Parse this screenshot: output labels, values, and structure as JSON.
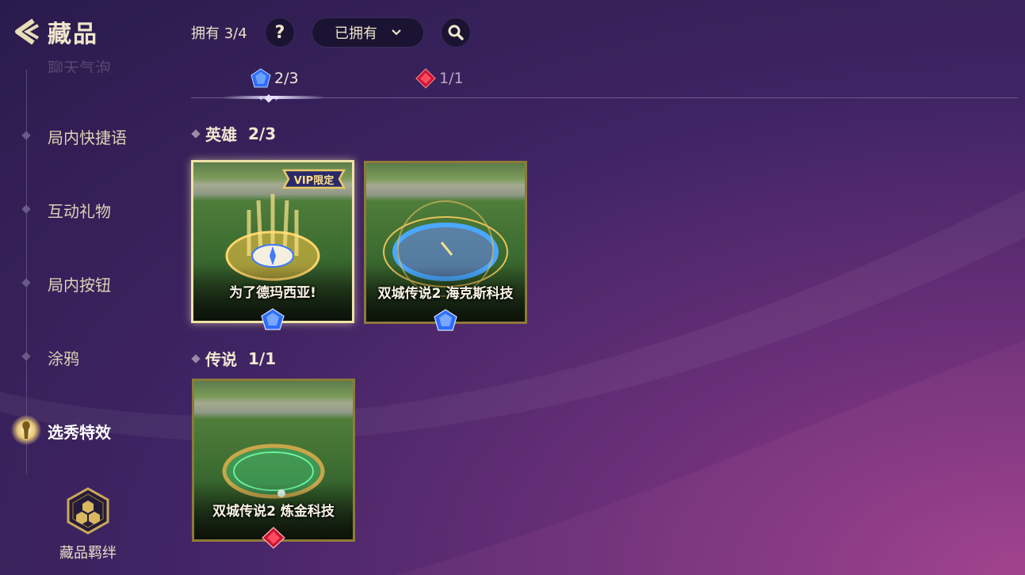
{
  "header": {
    "title": "藏品",
    "owned_label": "拥有 3/4",
    "help_label": "?",
    "filter_selected": "已拥有"
  },
  "sidebar": {
    "faded_item": "聊天气泡",
    "items": [
      {
        "label": "局内快捷语"
      },
      {
        "label": "互动礼物"
      },
      {
        "label": "局内按钮"
      },
      {
        "label": "涂鸦"
      },
      {
        "label": "选秀特效"
      }
    ],
    "active_index": 4,
    "bond_label": "藏品羁绊"
  },
  "tabs": [
    {
      "label": "2/3",
      "gem": "blue-gem-icon",
      "active": true
    },
    {
      "label": "1/1",
      "gem": "red-gem-icon",
      "active": false
    }
  ],
  "sections": [
    {
      "title": "英雄",
      "count": "2/3",
      "cards": [
        {
          "name": "为了德玛西亚!",
          "badge": "VIP限定",
          "gem": "blue"
        },
        {
          "name": "双城传说2 海克斯科技",
          "gem": "blue"
        }
      ]
    },
    {
      "title": "传说",
      "count": "1/1",
      "cards": [
        {
          "name": "双城传说2 炼金科技",
          "gem": "red"
        }
      ]
    }
  ],
  "colors": {
    "blue_gem": "#3a7bff",
    "red_gem": "#d0203a",
    "gold_border": "#8e7a3a",
    "selected_border": "#efe2a6"
  }
}
